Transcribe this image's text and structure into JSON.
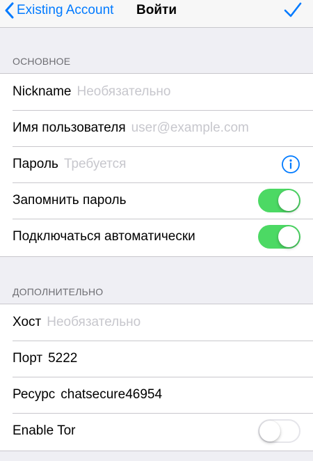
{
  "navbar": {
    "back_label": "Existing Account",
    "title": "Войти",
    "back_icon": "chevron-left-icon",
    "done_icon": "checkmark-icon"
  },
  "sections": {
    "basic": {
      "header": "ОСНОВНОЕ",
      "nickname": {
        "label": "Nickname",
        "placeholder": "Необязательно",
        "value": ""
      },
      "username": {
        "label": "Имя пользователя",
        "placeholder": "user@example.com",
        "value": ""
      },
      "password": {
        "label": "Пароль",
        "placeholder": "Требуется",
        "value": "",
        "icon": "info-icon"
      },
      "remember_password": {
        "label": "Запомнить пароль",
        "on": true
      },
      "auto_connect": {
        "label": "Подключаться автоматически",
        "on": true
      }
    },
    "advanced": {
      "header": "ДОПОЛНИТЕЛЬНО",
      "host": {
        "label": "Хост",
        "placeholder": "Необязательно",
        "value": ""
      },
      "port": {
        "label": "Порт",
        "value": "5222"
      },
      "resource": {
        "label": "Ресурс",
        "value": "chatsecure46954"
      },
      "enable_tor": {
        "label": "Enable Tor",
        "on": false
      }
    }
  },
  "colors": {
    "accent": "#007aff",
    "toggle_on": "#4cd964",
    "placeholder": "#c7c7cd",
    "background": "#efeff4"
  }
}
